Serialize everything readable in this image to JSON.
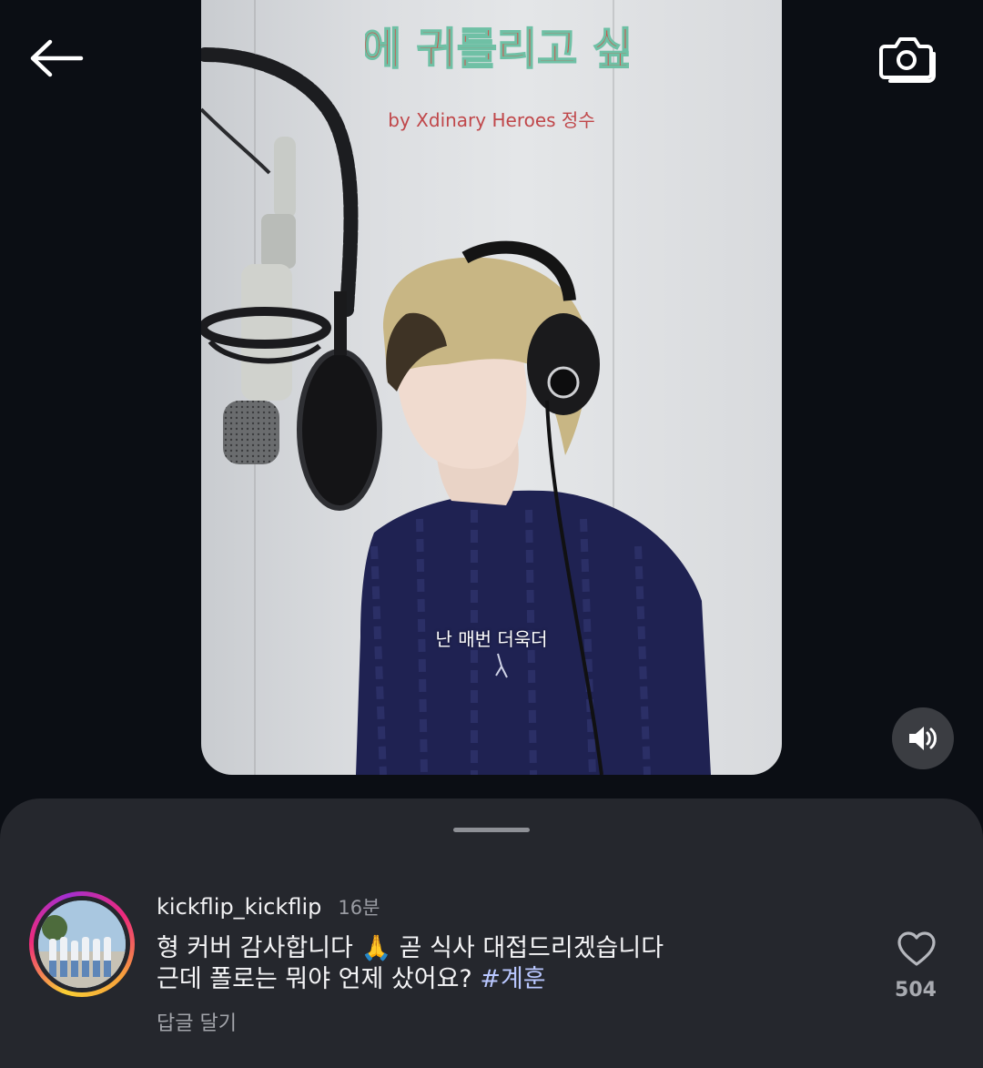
{
  "topbar": {
    "back_icon": "arrow-left-icon",
    "camera_icon": "camera-icon"
  },
  "video": {
    "title_art_text": "콘에 귀를리고 싶어",
    "credit": "by Xdinary Heroes 정수",
    "subtitle": "난 매번 더욱더",
    "mute_icon": "volume-icon"
  },
  "comment": {
    "username": "kickflip_kickflip",
    "time": "16분",
    "text_line1": "형 커버 감사합니다 🙏 곧 식사 대접드리겠습니다",
    "text_line2_prefix": "근데 폴로는 뭐야 언제 샀어요? ",
    "hashtag": "#계훈",
    "reply_label": "답글 달기",
    "like_count": "504",
    "like_icon": "heart-outline-icon"
  },
  "colors": {
    "background": "#0b0e14",
    "sheet": "#25272d",
    "hashtag": "#b9c7ff",
    "credit_text": "#c0474a"
  }
}
